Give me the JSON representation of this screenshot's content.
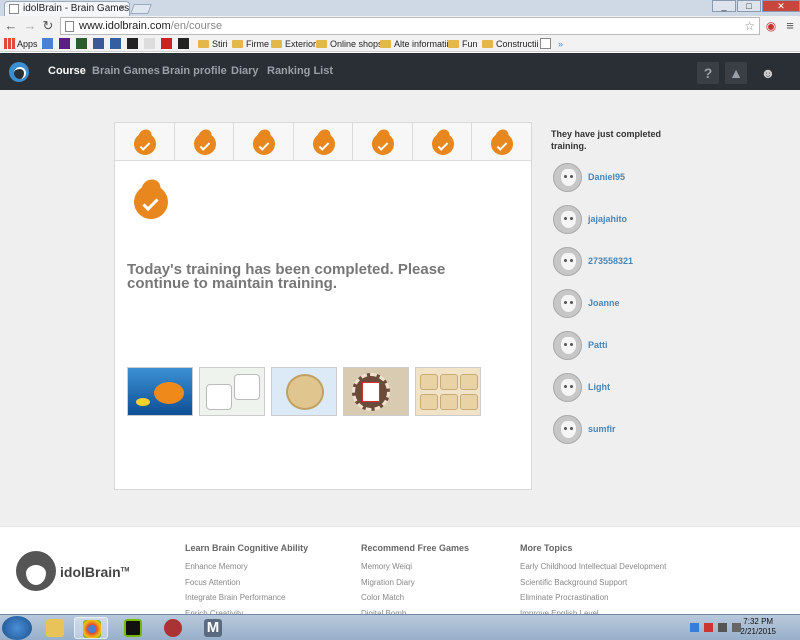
{
  "browser": {
    "tab_title": "idolBrain - Brain Games &",
    "url_domain": "www.idolbrain.com",
    "url_path": "/en/course",
    "bookmarks": [
      {
        "label": "Apps",
        "kind": "apps"
      },
      {
        "label": "Stiri",
        "kind": "folder"
      },
      {
        "label": "Firme",
        "kind": "folder"
      },
      {
        "label": "Exterior",
        "kind": "folder"
      },
      {
        "label": "Online shops",
        "kind": "folder"
      },
      {
        "label": "Alte informatii",
        "kind": "folder"
      },
      {
        "label": "Fun",
        "kind": "folder"
      },
      {
        "label": "Constructii",
        "kind": "folder"
      }
    ]
  },
  "site": {
    "nav": [
      "Course",
      "Brain Games",
      "Brain profile",
      "Diary",
      "Ranking List"
    ],
    "active_nav": "Course",
    "help_label": "?"
  },
  "course": {
    "days_completed": 7,
    "message": "Today's training has been completed. Please continue to maintain training.",
    "games": [
      "fish-game",
      "dice-game",
      "weiqi-game",
      "record-game",
      "puzzle-game"
    ]
  },
  "sidebar": {
    "heading": "They have just completed training.",
    "users": [
      "Daniel95",
      "jajajahito",
      "273558321",
      "Joanne",
      "Patti",
      "Light",
      "sumfir"
    ]
  },
  "footer": {
    "brand": "idolBrain",
    "brand_mark": "TM",
    "columns": [
      {
        "title": "Learn Brain Cognitive Ability",
        "links": [
          "Enhance Memory",
          "Focus Attention",
          "Integrate Brain Performance",
          "Enrich Creativity"
        ]
      },
      {
        "title": "Recommend Free Games",
        "links": [
          "Memory Weiqi",
          "Migration Diary",
          "Color Match",
          "Digital Bomb"
        ]
      },
      {
        "title": "More Topics",
        "links": [
          "Early Childhood Intellectual Development",
          "Scientific Background Support",
          "Eliminate Procrastination",
          "Improve English Level"
        ]
      }
    ]
  },
  "taskbar": {
    "time": "7:32 PM",
    "date": "2/21/2015"
  }
}
